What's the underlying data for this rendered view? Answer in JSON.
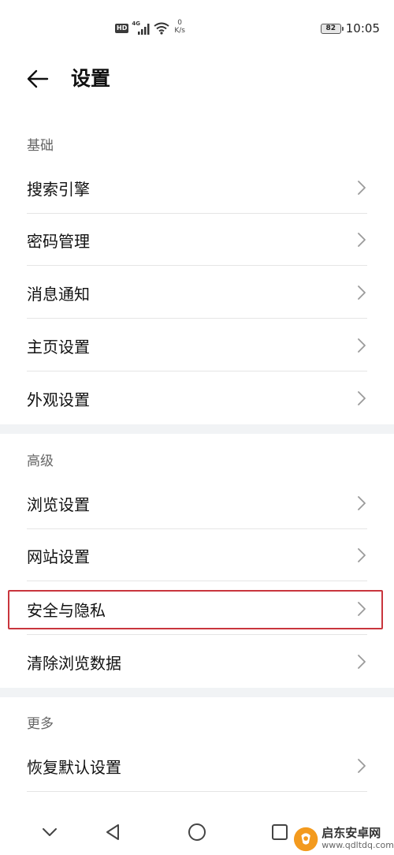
{
  "status_bar": {
    "hd_badge": "HD",
    "network": "4G",
    "speed_value": "0",
    "speed_unit": "K/s",
    "battery": "82",
    "time": "10:05"
  },
  "header": {
    "title": "设置"
  },
  "sections": [
    {
      "title": "基础",
      "items": [
        "搜索引擎",
        "密码管理",
        "消息通知",
        "主页设置",
        "外观设置"
      ]
    },
    {
      "title": "高级",
      "items": [
        "浏览设置",
        "网站设置",
        "安全与隐私",
        "清除浏览数据"
      ]
    },
    {
      "title": "更多",
      "items": [
        "恢复默认设置"
      ]
    }
  ],
  "highlighted_item": "安全与隐私",
  "nav_bar": {
    "icons": [
      "chevron-down-icon",
      "back-triangle-icon",
      "home-circle-icon",
      "recents-square-icon"
    ]
  },
  "watermark": {
    "title": "启东安卓网",
    "url": "www.qdltdq.com"
  },
  "colors": {
    "highlight_border": "#c9353d",
    "section_gap": "#f1f3f5",
    "divider": "#e5e5e5",
    "watermark_orange": "#f39a1e"
  }
}
